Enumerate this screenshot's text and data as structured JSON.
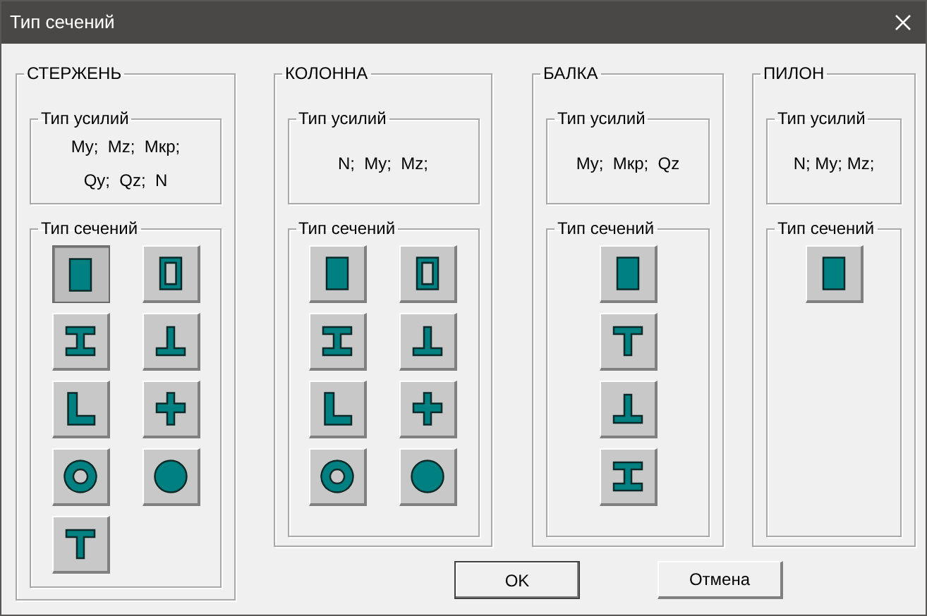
{
  "window": {
    "title": "Тип сечений"
  },
  "groups": [
    {
      "title": "СТЕРЖЕНЬ",
      "forces": {
        "title": "Тип усилий",
        "lines": [
          "My;  Mz;  Mкр;",
          "Qy;  Qz;  N"
        ]
      },
      "sections": {
        "title": "Тип сечений",
        "items": [
          {
            "kind": "solid-rect",
            "selected": true
          },
          {
            "kind": "hollow-rect",
            "selected": false
          },
          {
            "kind": "i-beam",
            "selected": false
          },
          {
            "kind": "inverted-tee",
            "selected": false
          },
          {
            "kind": "angle",
            "selected": false
          },
          {
            "kind": "cross",
            "selected": false
          },
          {
            "kind": "ring",
            "selected": false
          },
          {
            "kind": "circle",
            "selected": false
          },
          {
            "kind": "tee",
            "selected": false
          }
        ]
      }
    },
    {
      "title": "КОЛОННА",
      "forces": {
        "title": "Тип усилий",
        "lines": [
          "N;  My;  Mz;"
        ]
      },
      "sections": {
        "title": "Тип сечений",
        "items": [
          {
            "kind": "solid-rect",
            "selected": false
          },
          {
            "kind": "hollow-rect",
            "selected": false
          },
          {
            "kind": "i-beam",
            "selected": false
          },
          {
            "kind": "inverted-tee",
            "selected": false
          },
          {
            "kind": "angle",
            "selected": false
          },
          {
            "kind": "cross",
            "selected": false
          },
          {
            "kind": "ring",
            "selected": false
          },
          {
            "kind": "circle",
            "selected": false
          }
        ]
      }
    },
    {
      "title": "БАЛКА",
      "forces": {
        "title": "Тип усилий",
        "lines": [
          "My;  Mкр;  Qz"
        ]
      },
      "sections": {
        "title": "Тип сечений",
        "items": [
          {
            "kind": "solid-rect",
            "selected": false
          },
          {
            "kind": "tee",
            "selected": false
          },
          {
            "kind": "inverted-tee",
            "selected": false
          },
          {
            "kind": "i-beam",
            "selected": false
          }
        ]
      }
    },
    {
      "title": "ПИЛОН",
      "forces": {
        "title": "Тип усилий",
        "lines": [
          "N; My; Mz;"
        ]
      },
      "sections": {
        "title": "Тип сечений",
        "items": [
          {
            "kind": "solid-rect",
            "selected": false
          }
        ]
      }
    }
  ],
  "buttons": [
    {
      "label": "OK",
      "default": true
    },
    {
      "label": "Отмена",
      "default": false
    }
  ]
}
